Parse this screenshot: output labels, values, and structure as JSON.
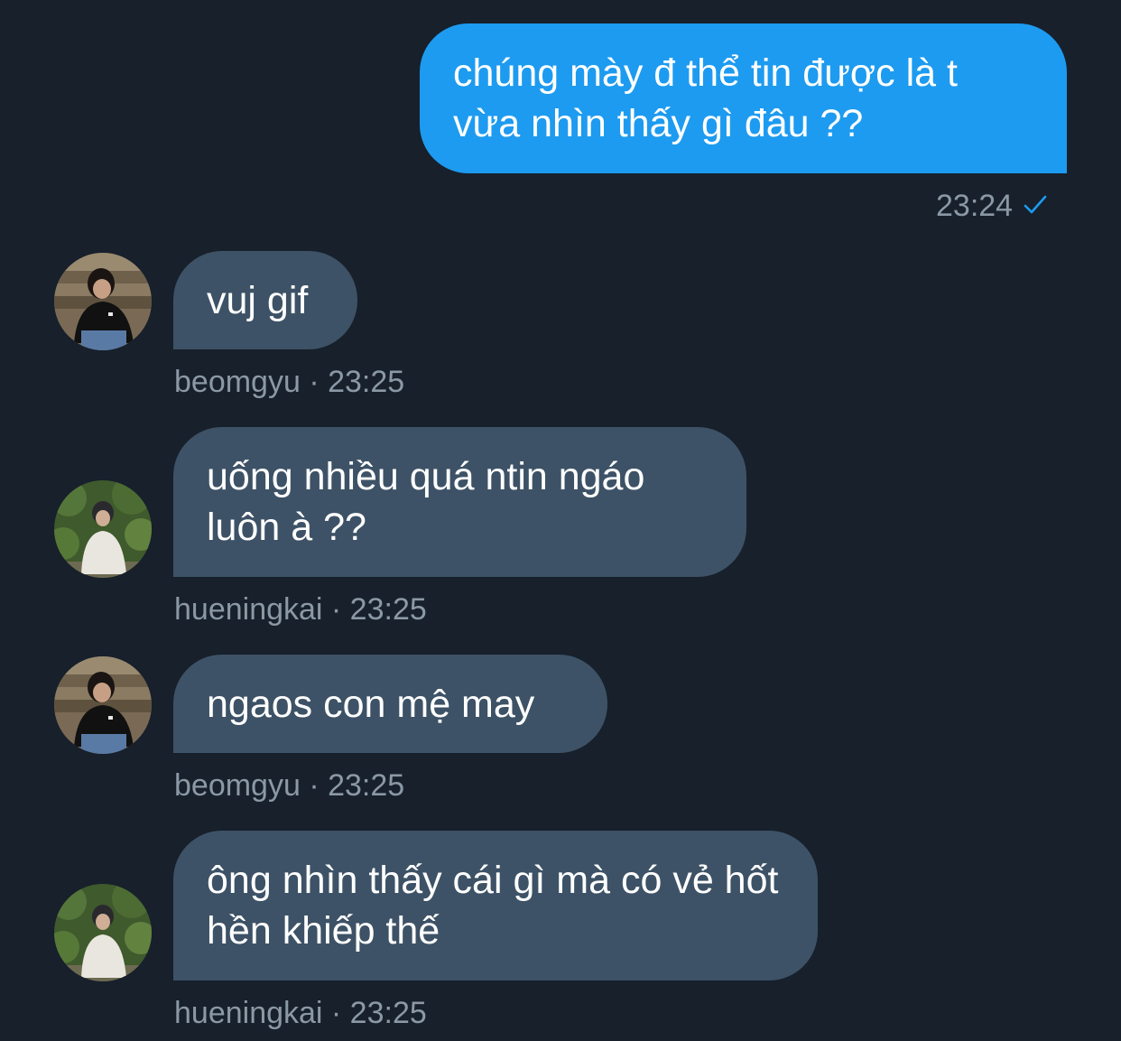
{
  "messages": [
    {
      "direction": "sent",
      "text": "chúng mày đ thể tin được là t vừa nhìn thấy gì đâu ??",
      "time": "23:24",
      "status_icon": "sent-check-icon"
    },
    {
      "direction": "received",
      "sender": "beomgyu",
      "text": "vuj gif",
      "time": "23:25",
      "meta": "beomgyu · 23:25",
      "avatar": "beomgyu-avatar"
    },
    {
      "direction": "received",
      "sender": "hueningkai",
      "text": "uống nhiều quá ntin ngáo luôn à ??",
      "time": "23:25",
      "meta": "hueningkai · 23:25",
      "avatar": "hueningkai-avatar"
    },
    {
      "direction": "received",
      "sender": "beomgyu",
      "text": "ngaos con mệ may",
      "time": "23:25",
      "meta": "beomgyu · 23:25",
      "avatar": "beomgyu-avatar"
    },
    {
      "direction": "received",
      "sender": "hueningkai",
      "text": "ông nhìn thấy cái gì mà có vẻ hốt hền khiếp thế",
      "time": "23:25",
      "meta": "hueningkai · 23:25",
      "avatar": "hueningkai-avatar"
    }
  ],
  "colors": {
    "background": "#17202b",
    "sent_bubble": "#1d9bf0",
    "received_bubble": "#3d5266",
    "meta_text": "#8b98a5",
    "check": "#1d9bf0"
  }
}
